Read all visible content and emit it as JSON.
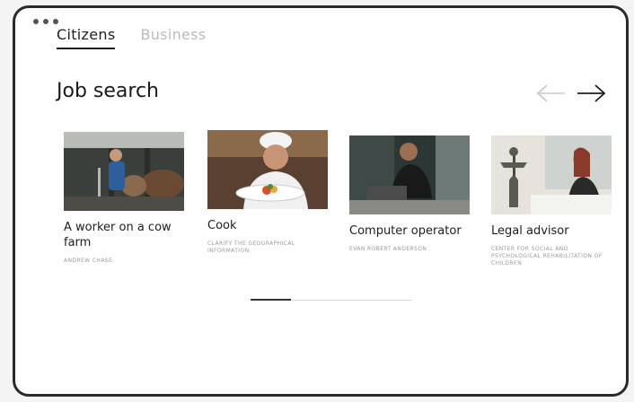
{
  "window": {
    "controls": [
      "dot",
      "dot",
      "dot"
    ]
  },
  "tabs": [
    {
      "label": "Citizens",
      "active": true
    },
    {
      "label": "Business",
      "active": false
    }
  ],
  "section": {
    "title": "Job search"
  },
  "nav": {
    "prev_icon": "arrow-left-icon",
    "next_icon": "arrow-right-icon"
  },
  "cards": [
    {
      "title": "A worker on a cow farm",
      "subtitle": "ANDREW CHASE"
    },
    {
      "title": "Cook",
      "subtitle": "Clarify the geographical information"
    },
    {
      "title": "Computer operator",
      "subtitle": "EVAN ROBERT ANDERSON"
    },
    {
      "title": "Legal advisor",
      "subtitle": "CENTER FOR SOCIAL AND PSYCHOLOGICAL REHABILITATION OF CHILDREN"
    }
  ],
  "pager": {
    "current_fraction": 0.25
  },
  "colors": {
    "frame": "#2a2a2a",
    "accent": "#1e1e1e",
    "muted": "#bbbbbb"
  }
}
